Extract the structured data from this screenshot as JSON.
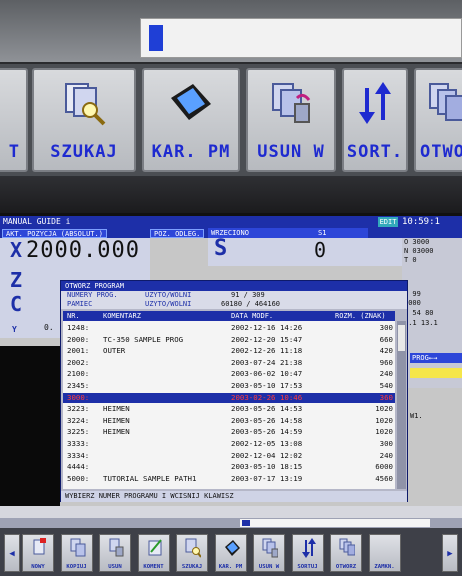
{
  "top_softkeys": [
    {
      "label": "T",
      "icon": "partial-key-icon"
    },
    {
      "label": "SZUKAJ",
      "icon": "magnifier-icon"
    },
    {
      "label": "KAR. PM",
      "icon": "memory-card-icon"
    },
    {
      "label": "USUN W",
      "icon": "delete-files-icon"
    },
    {
      "label": "SORT.",
      "icon": "sort-arrows-icon"
    },
    {
      "label": "OTWOR",
      "icon": "open-files-icon"
    }
  ],
  "header": {
    "mode": "MANUAL GUIDE i",
    "edit": "EDIT",
    "clock": "10:59:1"
  },
  "position": {
    "tab_abs": "AKT. POZYCJA (ABSOLUT.)",
    "tab_dist": "POZ. ODLEG.",
    "axis_x": "X",
    "x_value": "2000.000",
    "axis_z": "Z",
    "axis_c": "C",
    "axis_y": "Y",
    "y_value": "0."
  },
  "spindle": {
    "tab": "WRZECIONO",
    "channel": "S1",
    "letter": "S",
    "value": "0"
  },
  "right_info": {
    "o": "O 3000",
    "n": "N 03000",
    "t": "T 0",
    "m": "M 99",
    "v1": "3000",
    "v2": "0 54 80",
    "v3": "9.1  13.1"
  },
  "dialog": {
    "title": "OTWORZ PROGRAM",
    "numery_label": "NUMERY PROG.",
    "used_free_label": "UZYTO/WOLNI",
    "numery_value": "91 /     309",
    "pamiec_label": "PAMIEC",
    "pamiec_value": "60180 /  464160",
    "columns": {
      "nr": "NR.",
      "komentarz": "KOMENTARZ",
      "data": "DATA MODF.",
      "rozm": "ROZM. (ZNAK)"
    },
    "rows": [
      {
        "nr": "1248:",
        "comment": "",
        "date": "2002-12-16 14:26",
        "size": "300"
      },
      {
        "nr": "2000:",
        "comment": "TC-350 SAMPLE PROG",
        "date": "2002-12-20 15:47",
        "size": "660"
      },
      {
        "nr": "2001:",
        "comment": "OUTER",
        "date": "2002-12-26 11:18",
        "size": "420"
      },
      {
        "nr": "2002:",
        "comment": "",
        "date": "2003-07-24 21:38",
        "size": "960"
      },
      {
        "nr": "2100:",
        "comment": "",
        "date": "2003-06-02 10:47",
        "size": "240"
      },
      {
        "nr": "2345:",
        "comment": "",
        "date": "2003-05-10 17:53",
        "size": "540"
      },
      {
        "nr": "3000:",
        "comment": "",
        "date": "2003-02-26 10:46",
        "size": "360"
      },
      {
        "nr": "3223:",
        "comment": "HEIMEN",
        "date": "2003-05-26 14:53",
        "size": "1020"
      },
      {
        "nr": "3224:",
        "comment": "HEIMEN",
        "date": "2003-05-26 14:58",
        "size": "1020"
      },
      {
        "nr": "3225:",
        "comment": "HEIMEN",
        "date": "2003-05-26 14:59",
        "size": "1020"
      },
      {
        "nr": "3333:",
        "comment": "",
        "date": "2002-12-05 13:08",
        "size": "300"
      },
      {
        "nr": "3334:",
        "comment": "",
        "date": "2002-12-04 12:02",
        "size": "240"
      },
      {
        "nr": "4444:",
        "comment": "",
        "date": "2003-05-10 18:15",
        "size": "6000"
      },
      {
        "nr": "5000:",
        "comment": "TUTORIAL SAMPLE PATH1",
        "date": "2003-07-17 13:19",
        "size": "4560"
      }
    ],
    "status": "WYBIERZ NUMER PROGRAMU I WCISNIJ KLAWISZ"
  },
  "prog_tab": "PROG←→",
  "right_text": "W1.",
  "softkeys": [
    {
      "label": "NOWY",
      "icon": "new-file-icon"
    },
    {
      "label": "KOPIUJ",
      "icon": "copy-file-icon"
    },
    {
      "label": "USUN",
      "icon": "delete-file-icon"
    },
    {
      "label": "KOMENT",
      "icon": "comment-icon"
    },
    {
      "label": "SZUKAJ",
      "icon": "search-icon"
    },
    {
      "label": "KAR. PM",
      "icon": "memory-card-icon"
    },
    {
      "label": "USUN W",
      "icon": "delete-all-icon"
    },
    {
      "label": "SORTUJ",
      "icon": "sort-icon"
    },
    {
      "label": "OTWORZ",
      "icon": "open-icon"
    },
    {
      "label": "ZAMKN.",
      "icon": "close-icon"
    }
  ],
  "colors": {
    "accent": "#1d2fa8",
    "selected_text": "#ff3b3b",
    "label_blue": "#1e2ad0"
  }
}
